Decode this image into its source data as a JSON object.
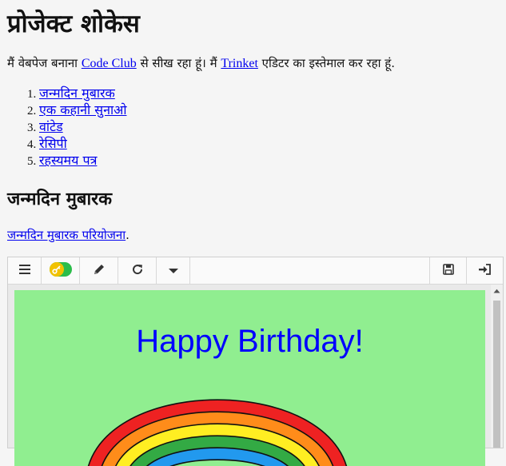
{
  "header": {
    "title": "प्रोजेक्ट शोकेस"
  },
  "intro": {
    "part1": "मैं वेबपेज बनाना ",
    "link1": "Code Club",
    "part2": " से सीख रहा हूं। मैं ",
    "link2": "Trinket",
    "part3": " एडिटर का इस्तेमाल कर रहा हूं."
  },
  "projects": [
    {
      "num": "1.",
      "label": "जन्मदिन मुबारक"
    },
    {
      "num": "2.",
      "label": "एक कहानी सुनाओ"
    },
    {
      "num": "3.",
      "label": "वांटेड"
    },
    {
      "num": "4.",
      "label": "रेसिपी"
    },
    {
      "num": "5.",
      "label": "रहस्यमय पत्र"
    }
  ],
  "section": {
    "heading": "जन्मदिन मुबारक",
    "project_link": "जन्मदिन मुबारक परियोजना",
    "project_suffix": "."
  },
  "trinket": {
    "toolbar_icons": [
      "menu-icon",
      "key-toggle-icon",
      "pencil-icon",
      "refresh-icon",
      "caret-down-icon",
      "save-icon",
      "sign-in-icon"
    ],
    "canvas_text": "Happy Birthday!",
    "canvas_bg": "#90ee90",
    "canvas_text_color": "#0000ff",
    "rainbow_colors": [
      "#ee2222",
      "#ff8c1a",
      "#ffee22",
      "#33aa44",
      "#2299ee"
    ]
  }
}
